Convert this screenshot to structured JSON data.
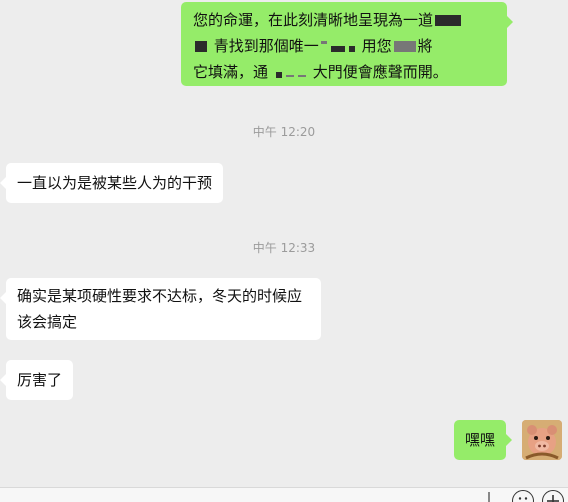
{
  "messages": [
    {
      "side": "out",
      "lines": [
        "您的命運，在此刻清晰地呈現為一道",
        "青找到那個唯一",
        "用您",
        "將",
        "它填滿，通",
        "大門便會應聲而開。"
      ]
    },
    {
      "side": "timestamp",
      "text": "中午 12:20"
    },
    {
      "side": "in",
      "text": "一直以为是被某些人为的干预"
    },
    {
      "side": "timestamp",
      "text": "中午 12:33"
    },
    {
      "side": "in",
      "lines": [
        "确实是某项硬性要求不达标，冬天的时候应",
        "该会搞定"
      ]
    },
    {
      "side": "in",
      "text": "厉害了"
    },
    {
      "side": "out",
      "text": "嘿嘿"
    }
  ],
  "avatar": {
    "icon": "cartoon-pig-avatar-icon"
  },
  "input_bar": {
    "icons": [
      "voice-icon",
      "emoji-icon",
      "add-icon"
    ]
  },
  "colors": {
    "background": "#ededed",
    "outgoing_bubble": "#95ec69",
    "incoming_bubble": "#ffffff",
    "timestamp": "#9b9b9b"
  }
}
